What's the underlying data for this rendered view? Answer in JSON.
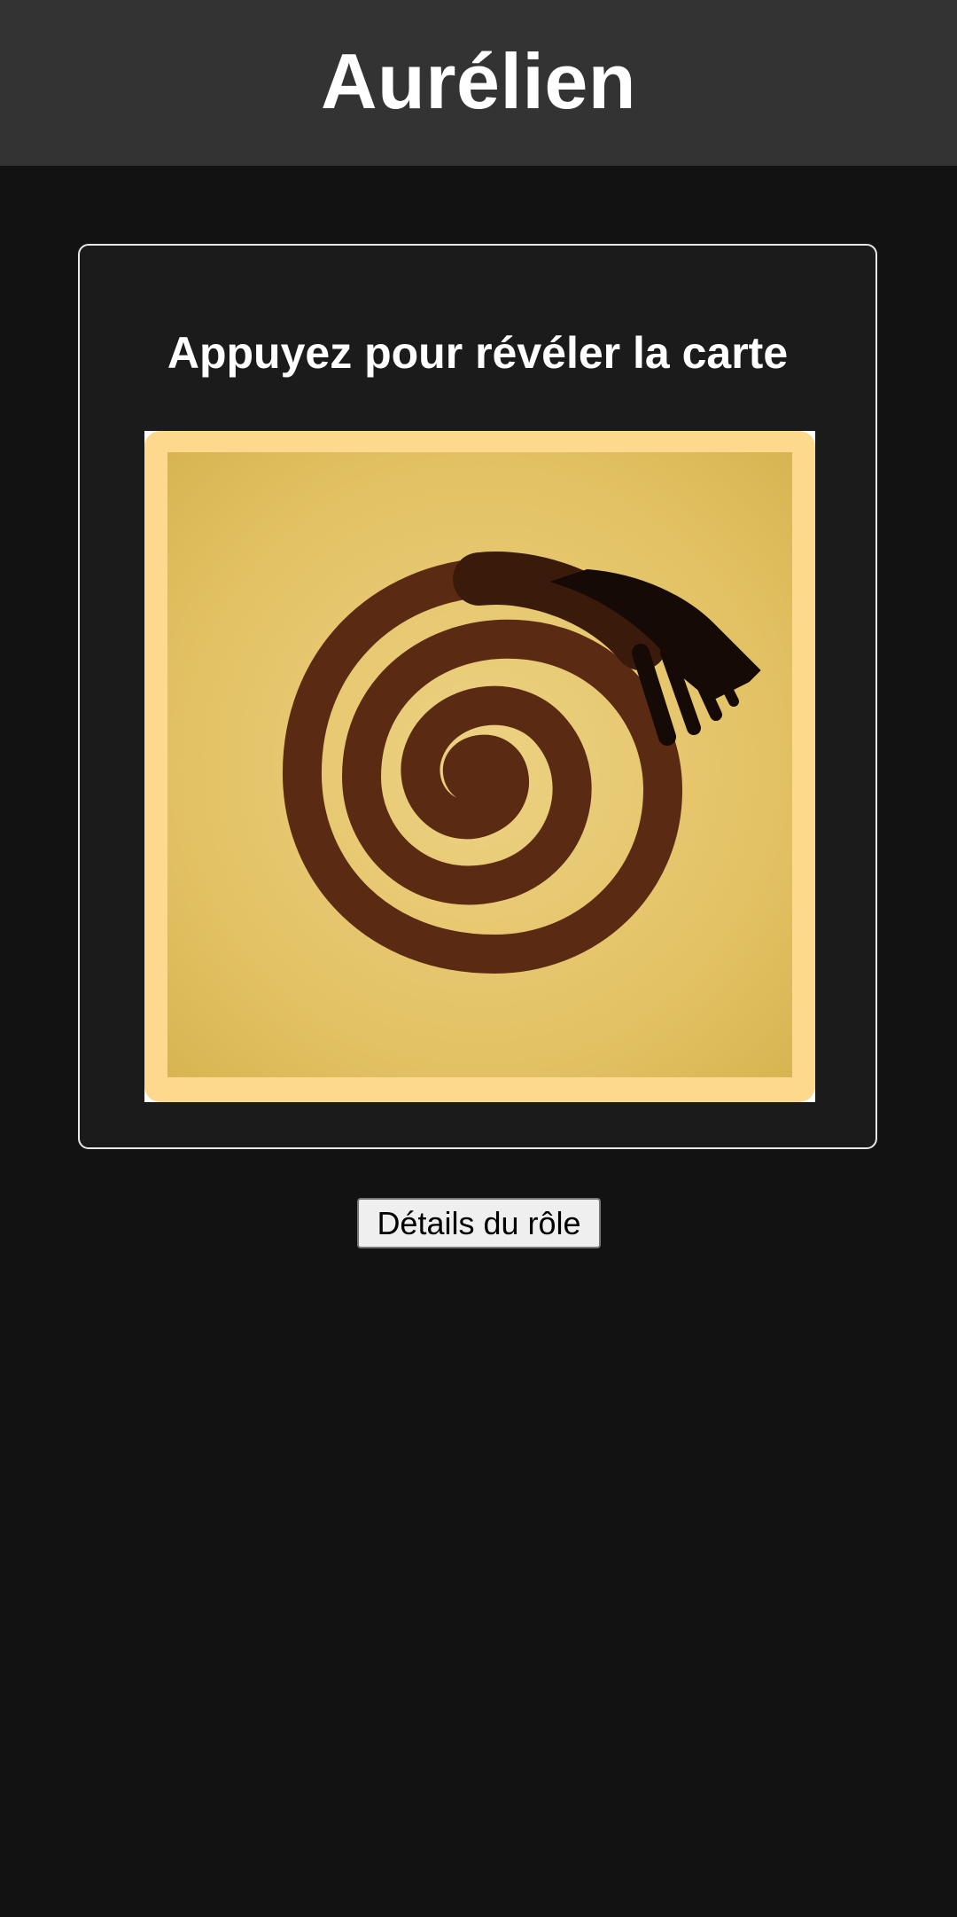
{
  "header": {
    "title": "Aurélien"
  },
  "card": {
    "prompt": "Appuyez pour révéler la carte",
    "image": "spiral-card-back"
  },
  "actions": {
    "role_details_label": "Détails du rôle"
  },
  "colors": {
    "background": "#121212",
    "header_bg": "#333333",
    "card_bg": "#1b1b1b",
    "card_border": "#e8e8e8",
    "card_gold": "#e6c66c",
    "spiral_brown": "#5a2a12",
    "spiral_dark": "#150a06"
  }
}
